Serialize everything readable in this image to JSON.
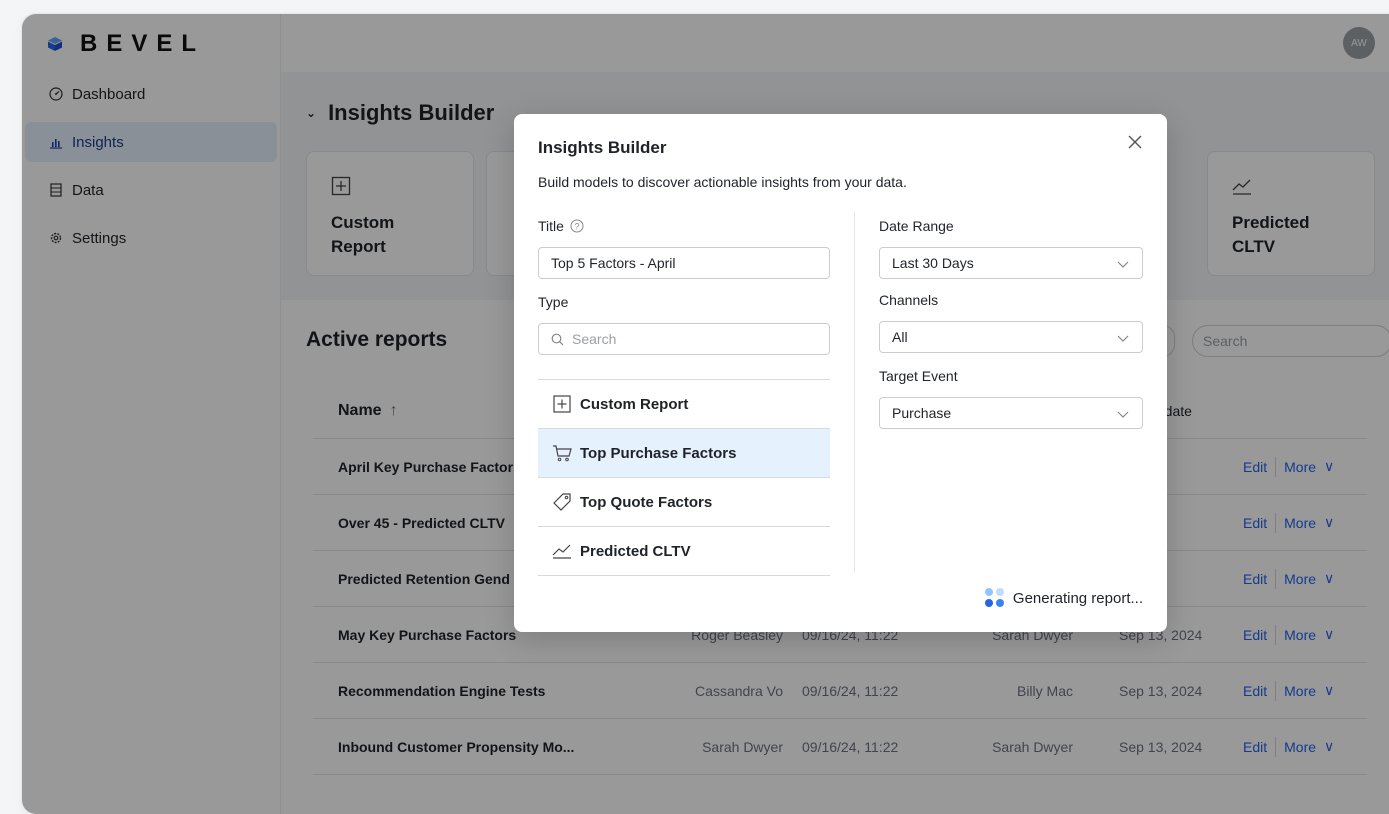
{
  "brand": {
    "name": "BEVEL",
    "color": "#2563eb"
  },
  "sidebar": {
    "items": [
      {
        "label": "Dashboard",
        "icon": "gauge-icon"
      },
      {
        "label": "Insights",
        "icon": "bar-chart-icon",
        "active": true
      },
      {
        "label": "Data",
        "icon": "table-icon"
      },
      {
        "label": "Settings",
        "icon": "gear-icon"
      }
    ]
  },
  "header": {
    "avatar_initials": "AW"
  },
  "builder": {
    "title": "Insights Builder",
    "cards": [
      {
        "label": "Custom Report",
        "icon": "plus-square-icon"
      },
      {
        "label": "Predicted CLTV",
        "icon": "trend-line-icon"
      }
    ]
  },
  "reports": {
    "title": "Active reports",
    "search_placeholder": "Search",
    "columns": {
      "name": "Name",
      "modified": "d date"
    },
    "rows": [
      {
        "name": "April Key Purchase Factor",
        "owner": "",
        "created": "",
        "modified_by": "",
        "modified_date": "2024",
        "edit": "Edit",
        "more": "More"
      },
      {
        "name": "Over 45 - Predicted CLTV",
        "owner": "",
        "created": "",
        "modified_by": "",
        "modified_date": "2024",
        "edit": "Edit",
        "more": "More"
      },
      {
        "name": "Predicted Retention Gend",
        "owner": "",
        "created": "",
        "modified_by": "",
        "modified_date": "2024",
        "edit": "Edit",
        "more": "More"
      },
      {
        "name": "May Key Purchase Factors",
        "owner": "Roger Beasley",
        "created": "09/16/24, 11:22",
        "modified_by": "Sarah Dwyer",
        "modified_date": "Sep 13, 2024",
        "edit": "Edit",
        "more": "More"
      },
      {
        "name": "Recommendation Engine Tests",
        "owner": "Cassandra Vo",
        "created": "09/16/24, 11:22",
        "modified_by": "Billy Mac",
        "modified_date": "Sep 13, 2024",
        "edit": "Edit",
        "more": "More"
      },
      {
        "name": "Inbound Customer Propensity Mo...",
        "owner": "Sarah Dwyer",
        "created": "09/16/24, 11:22",
        "modified_by": "Sarah Dwyer",
        "modified_date": "Sep 13, 2024",
        "edit": "Edit",
        "more": "More"
      }
    ]
  },
  "modal": {
    "title": "Insights Builder",
    "description": "Build models to discover actionable insights from your data.",
    "title_label": "Title",
    "title_value": "Top 5 Factors - April",
    "type_label": "Type",
    "type_search_placeholder": "Search",
    "types": [
      {
        "label": "Custom Report",
        "icon": "plus-square-icon"
      },
      {
        "label": "Top Purchase Factors",
        "icon": "cart-icon",
        "selected": true
      },
      {
        "label": "Top Quote Factors",
        "icon": "tag-icon"
      },
      {
        "label": "Predicted CLTV",
        "icon": "trend-line-icon"
      }
    ],
    "date_range_label": "Date Range",
    "date_range_value": "Last 30 Days",
    "channels_label": "Channels",
    "channels_value": "All",
    "target_event_label": "Target Event",
    "target_event_value": "Purchase",
    "status_text": "Generating report..."
  }
}
